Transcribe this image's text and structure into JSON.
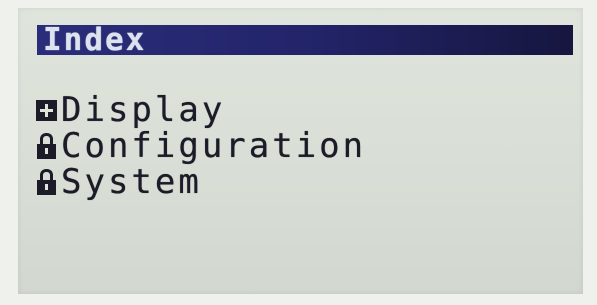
{
  "header": {
    "title": "Index"
  },
  "menu": {
    "items": [
      {
        "label": "Display",
        "icon": "plus-box-icon"
      },
      {
        "label": "Configuration",
        "icon": "lock-icon"
      },
      {
        "label": "System",
        "icon": "lock-icon"
      }
    ]
  },
  "colors": {
    "lcd_background": "#dfe5dc",
    "header_background": "#23246a",
    "header_text": "#dde3ee",
    "text": "#1b1c28"
  }
}
